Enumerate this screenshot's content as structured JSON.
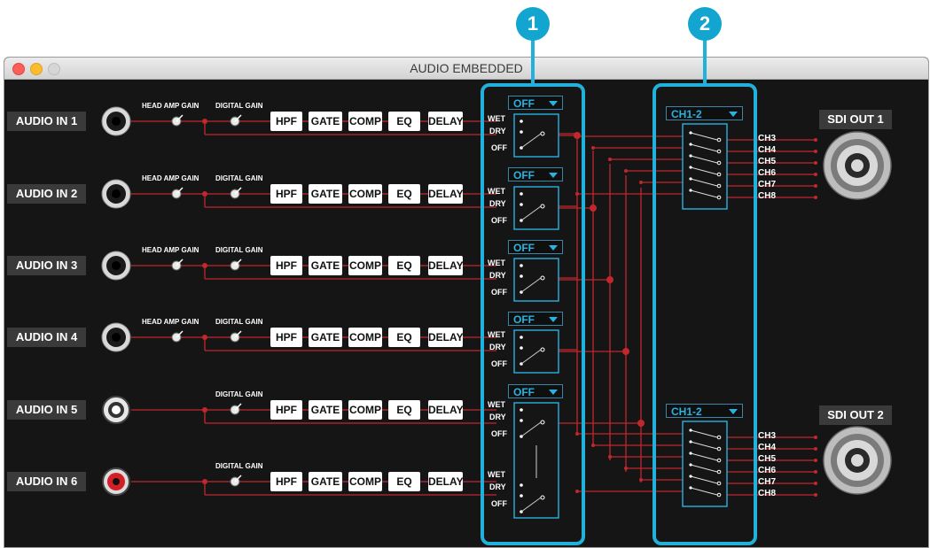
{
  "window": {
    "title": "AUDIO EMBEDDED"
  },
  "inputs": [
    {
      "label": "AUDIO IN 1",
      "connector": "xlr-jack"
    },
    {
      "label": "AUDIO IN 2",
      "connector": "xlr-jack"
    },
    {
      "label": "AUDIO IN 3",
      "connector": "xlr-jack"
    },
    {
      "label": "AUDIO IN 4",
      "connector": "xlr-jack"
    },
    {
      "label": "AUDIO IN 5",
      "connector": "rca-white"
    },
    {
      "label": "AUDIO IN 6",
      "connector": "rca-red"
    }
  ],
  "gain_labels": {
    "head_amp": "HEAD AMP GAIN",
    "digital": "DIGITAL GAIN"
  },
  "effects": [
    "HPF",
    "GATE",
    "COMP",
    "EQ",
    "DELAY"
  ],
  "mix_selects": [
    "OFF",
    "OFF",
    "OFF",
    "OFF",
    "OFF"
  ],
  "switch_labels": {
    "wet": "WET",
    "dry": "DRY",
    "off": "OFF"
  },
  "outputs": [
    {
      "label": "SDI OUT 1",
      "select": "CH1-2",
      "channels": [
        "CH3",
        "CH4",
        "CH5",
        "CH6",
        "CH7",
        "CH8"
      ]
    },
    {
      "label": "SDI OUT 2",
      "select": "CH1-2",
      "channels": [
        "CH3",
        "CH4",
        "CH5",
        "CH6",
        "CH7",
        "CH8"
      ]
    }
  ],
  "callouts": [
    "1",
    "2"
  ],
  "colors": {
    "accent": "#22b1db",
    "signal": "#c0282d",
    "background": "#151515"
  }
}
